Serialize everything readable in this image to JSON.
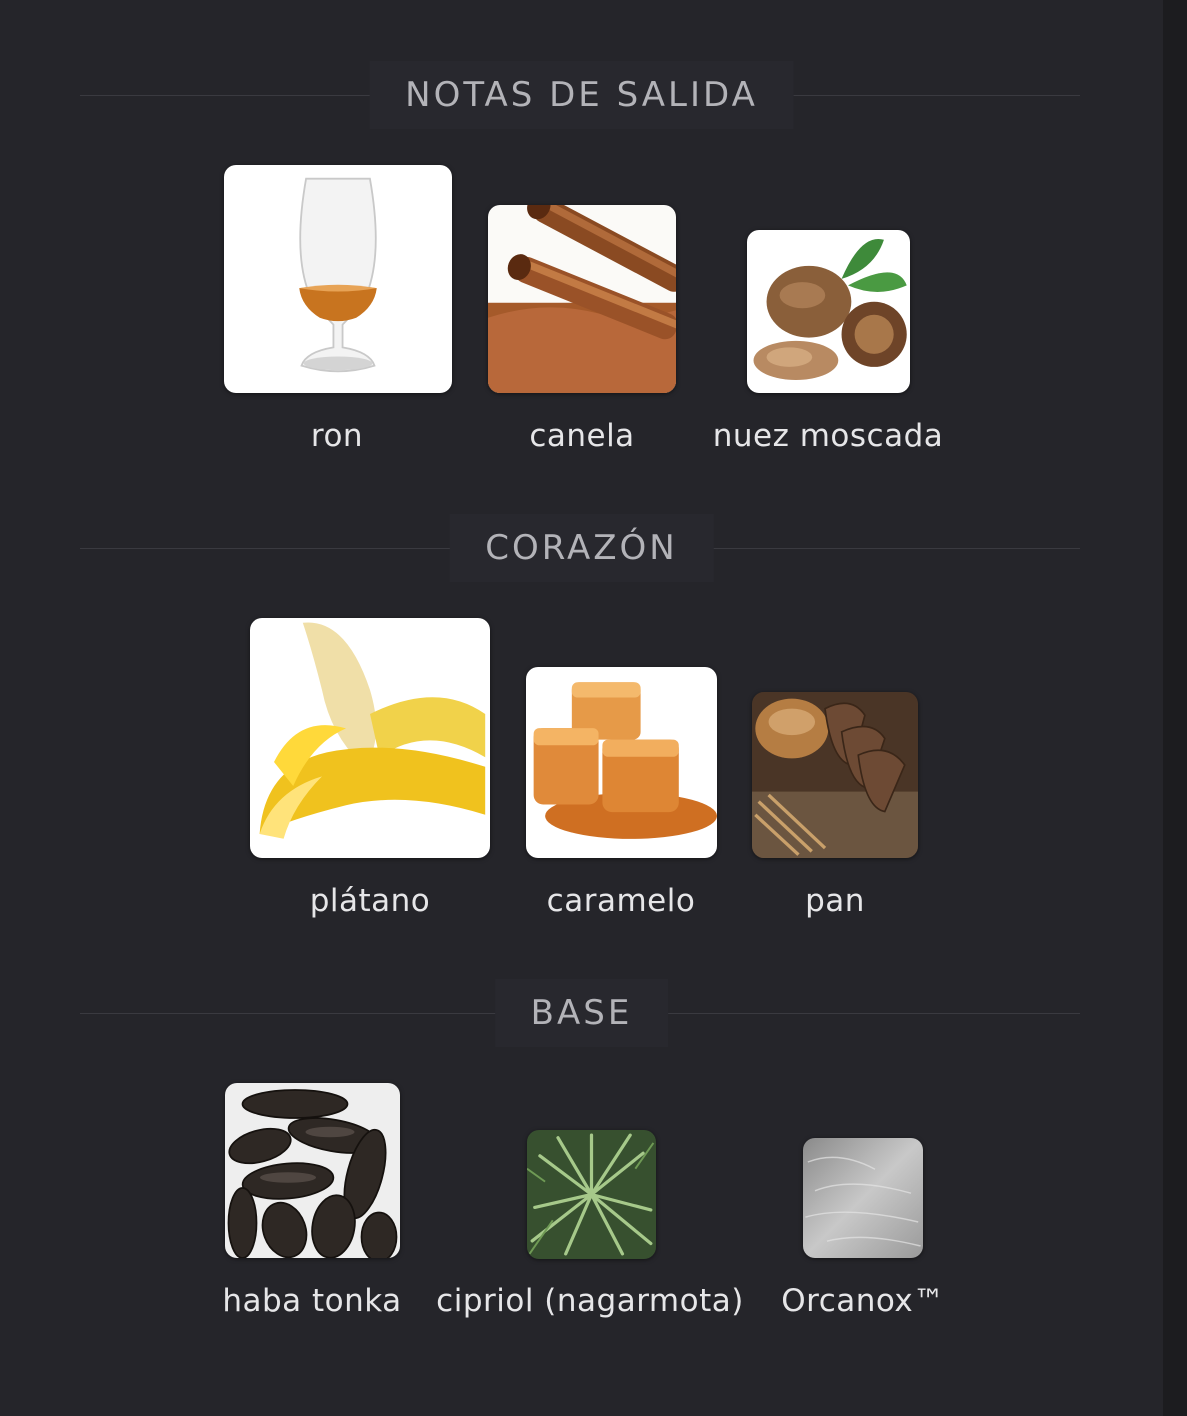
{
  "colors": {
    "background": "#25252a",
    "header_bg": "#28282e",
    "rule": "#3a3a40",
    "label_text": "#e6e6e8",
    "header_text": "#b3b3b8"
  },
  "sections": [
    {
      "title": "NOTAS DE SALIDA",
      "notes": [
        {
          "label": "ron",
          "image": "rum-glass-image"
        },
        {
          "label": "canela",
          "image": "cinnamon-image"
        },
        {
          "label": "nuez moscada",
          "image": "nutmeg-image"
        }
      ]
    },
    {
      "title": "CORAZÓN",
      "notes": [
        {
          "label": "plátano",
          "image": "banana-image"
        },
        {
          "label": "caramelo",
          "image": "caramel-image"
        },
        {
          "label": "pan",
          "image": "bread-image"
        }
      ]
    },
    {
      "title": "BASE",
      "notes": [
        {
          "label": "haba tonka",
          "image": "tonka-bean-image"
        },
        {
          "label": "cipriol (nagarmota)",
          "image": "cypriol-plant-image"
        },
        {
          "label": "Orcanox™",
          "image": "orcanox-texture-image"
        }
      ]
    }
  ]
}
